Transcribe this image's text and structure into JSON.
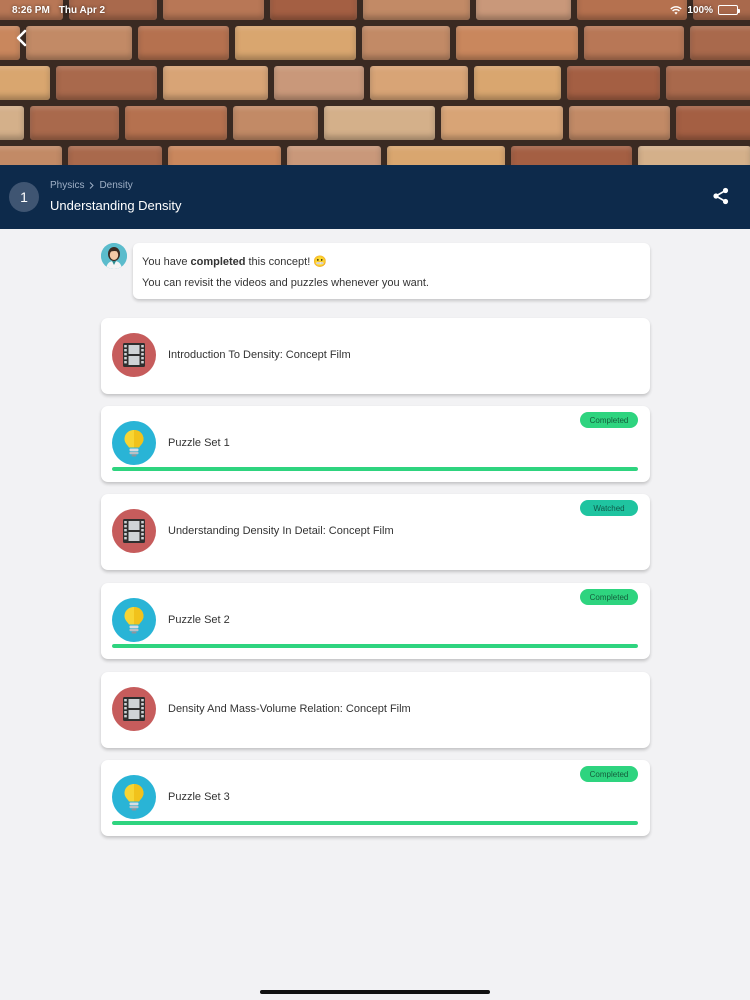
{
  "status_bar": {
    "time": "8:26 PM",
    "date": "Thu Apr 2",
    "battery": "100%"
  },
  "header": {
    "step_number": "1",
    "breadcrumb": [
      "Physics",
      "Density"
    ],
    "title": "Understanding Density"
  },
  "message": {
    "prefix": "You have",
    "bold": "completed",
    "suffix": "this concept!",
    "emoji": "😬",
    "line2": "You can revisit the videos and puzzles whenever you want."
  },
  "cards": [
    {
      "title": "Introduction To Density: Concept Film",
      "icon": "film-icon",
      "badge": "",
      "progress": null
    },
    {
      "title": "Puzzle Set 1",
      "icon": "bulb-icon",
      "badge": "Completed",
      "progress": 1.0
    },
    {
      "title": "Understanding Density In Detail: Concept Film",
      "icon": "film-icon",
      "badge": "Watched",
      "progress": null
    },
    {
      "title": "Puzzle Set 2",
      "icon": "bulb-icon",
      "badge": "Completed",
      "progress": 1.0
    },
    {
      "title": "Density And Mass-Volume Relation: Concept Film",
      "icon": "film-icon",
      "badge": "",
      "progress": null
    },
    {
      "title": "Puzzle Set 3",
      "icon": "bulb-icon",
      "badge": "Completed",
      "progress": 1.0
    }
  ],
  "colors": {
    "header_bg": "#0d2a4b",
    "film_icon_bg": "#c65c5c",
    "bulb_icon_bg": "#29b4d6",
    "completed_green": "#2ed47f",
    "watched_teal": "#1fc4a0"
  }
}
